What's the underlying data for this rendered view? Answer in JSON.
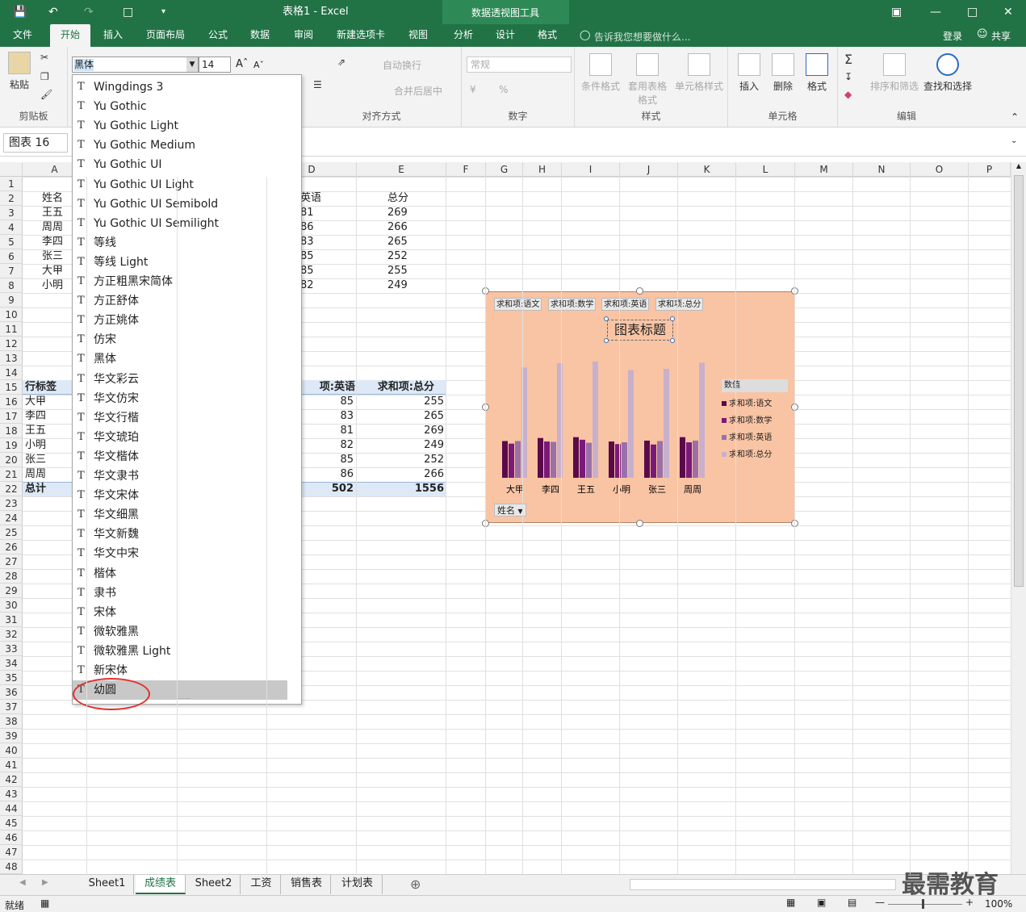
{
  "titlebar": {
    "doc_title": "表格1 - Excel",
    "tool_title": "数据透视图工具"
  },
  "tabs": [
    "文件",
    "开始",
    "插入",
    "页面布局",
    "公式",
    "数据",
    "审阅",
    "新建选项卡",
    "视图",
    "分析",
    "设计",
    "格式"
  ],
  "tell_me": "告诉我您想要做什么...",
  "login": "登录",
  "share": "共享",
  "ribbon": {
    "paste": "粘贴",
    "clipboard": "剪贴板",
    "font_name": "黑体",
    "font_size": "14",
    "wrap": "自动换行",
    "merge": "合并后居中",
    "align": "对齐方式",
    "number_format": "常规",
    "number": "数字",
    "cond_format": "条件格式",
    "table_format": "套用表格格式",
    "cell_style": "单元格样式",
    "styles": "样式",
    "insert": "插入",
    "delete": "删除",
    "format": "格式",
    "cells": "单元格",
    "sort": "排序和筛选",
    "find": "查找和选择",
    "editing": "编辑"
  },
  "namebox": "图表 16",
  "columns": [
    "A",
    "B",
    "C",
    "D",
    "E",
    "F",
    "G",
    "H",
    "I",
    "J",
    "K",
    "L",
    "M",
    "N",
    "O",
    "P"
  ],
  "rows": [
    1,
    2,
    3,
    4,
    5,
    6,
    7,
    8,
    9,
    10,
    11,
    12,
    13,
    14,
    15,
    16,
    17,
    18,
    19,
    20,
    21,
    22,
    23,
    24,
    25,
    26,
    27,
    28,
    29,
    30,
    31,
    32,
    33,
    34,
    35,
    36,
    37,
    38,
    39,
    40,
    41,
    42,
    43,
    44,
    45,
    46,
    47,
    48
  ],
  "table1": {
    "header": [
      "姓名",
      "英语",
      "总分"
    ],
    "rows": [
      [
        "王五",
        "81",
        "269"
      ],
      [
        "周周",
        "86",
        "266"
      ],
      [
        "李四",
        "83",
        "265"
      ],
      [
        "张三",
        "85",
        "252"
      ],
      [
        "大甲",
        "85",
        "255"
      ],
      [
        "小明",
        "82",
        "249"
      ]
    ]
  },
  "pivot": {
    "header": [
      "行标签",
      "项:英语",
      "求和项:总分"
    ],
    "rows": [
      [
        "大甲",
        "85",
        "255"
      ],
      [
        "李四",
        "83",
        "265"
      ],
      [
        "王五",
        "81",
        "269"
      ],
      [
        "小明",
        "82",
        "249"
      ],
      [
        "张三",
        "85",
        "252"
      ],
      [
        "周周",
        "86",
        "266"
      ]
    ],
    "total": [
      "总计",
      "502",
      "1556"
    ]
  },
  "fontlist": [
    "Wingdings 3",
    "Yu Gothic",
    "Yu Gothic Light",
    "Yu Gothic Medium",
    "Yu Gothic UI",
    "Yu Gothic UI Light",
    "Yu Gothic UI Semibold",
    "Yu Gothic UI Semilight",
    "等线",
    "等线 Light",
    "方正粗黑宋简体",
    "方正舒体",
    "方正姚体",
    "仿宋",
    "黑体",
    "华文彩云",
    "华文仿宋",
    "华文行楷",
    "华文琥珀",
    "华文楷体",
    "华文隶书",
    "华文宋体",
    "华文细黑",
    "华文新魏",
    "华文中宋",
    "楷体",
    "隶书",
    "宋体",
    "微软雅黑",
    "微软雅黑 Light",
    "新宋体",
    "幼圆"
  ],
  "fontlist_selected": "幼圆",
  "chart": {
    "field_buttons": [
      "求和项:语文",
      "求和项:数学",
      "求和项:英语",
      "求和项:总分"
    ],
    "title": "图表标题",
    "legend_title": "数值",
    "axis_field": "姓名",
    "colors": [
      "#5a0a4a",
      "#7a1a78",
      "#9a70a8",
      "#c8b0cc"
    ]
  },
  "chart_data": {
    "type": "bar",
    "categories": [
      "大甲",
      "李四",
      "王五",
      "小明",
      "张三",
      "周周"
    ],
    "series": [
      {
        "name": "求和项:语文",
        "values": [
          85,
          92,
          94,
          84,
          86,
          94
        ]
      },
      {
        "name": "求和项:数学",
        "values": [
          79,
          84,
          88,
          78,
          77,
          82
        ]
      },
      {
        "name": "求和项:英语",
        "values": [
          85,
          83,
          81,
          82,
          85,
          86
        ]
      },
      {
        "name": "求和项:总分",
        "values": [
          255,
          265,
          269,
          249,
          252,
          266
        ]
      }
    ],
    "ylim": [
      0,
      280
    ]
  },
  "sheets": [
    "Sheet1",
    "成绩表",
    "Sheet2",
    "工资",
    "销售表",
    "计划表"
  ],
  "active_sheet": "成绩表",
  "status": {
    "ready": "就绪",
    "zoom": "100%"
  },
  "watermark": "最需教育"
}
